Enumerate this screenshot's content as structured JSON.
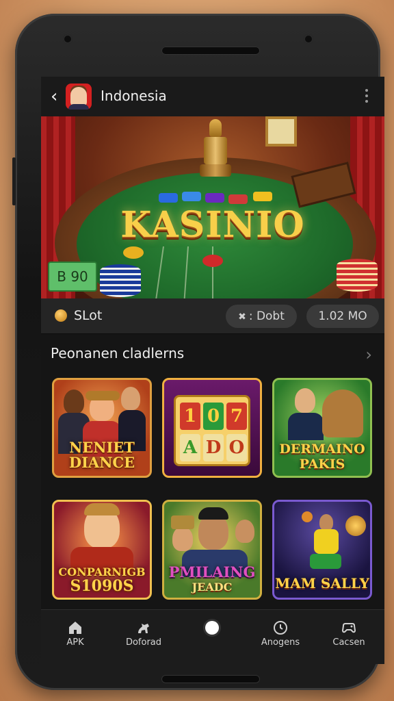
{
  "header": {
    "title": "Indonesia"
  },
  "hero": {
    "logo_text": "KASINIO",
    "money_note": "B 90"
  },
  "info_row": {
    "slot_label": "SLot",
    "pill_1": ": Dobt",
    "pill_2": "1.02 MO"
  },
  "section": {
    "title": "Peonanen cladlerns"
  },
  "games": [
    {
      "label_line1": "NENIET",
      "label_line2": "DIANCE"
    },
    {
      "reels_top": [
        "1",
        "0",
        "7"
      ],
      "reels_bottom": [
        "A",
        "D",
        "O"
      ]
    },
    {
      "label_line1": "DERMAINO",
      "label_line2": "PAKIS"
    },
    {
      "label_line1": "CONPARNIGB",
      "label_line2": "S1090S"
    },
    {
      "label_line1": "PMILAING",
      "label_line2": "JEADC"
    },
    {
      "label_line1": "MAM SALLY",
      "label_line2": ""
    }
  ],
  "bottom_nav": [
    {
      "label": "APK",
      "icon": "home-icon"
    },
    {
      "label": "Doforad",
      "icon": "horse-icon"
    },
    {
      "label": "",
      "icon": "circle-icon"
    },
    {
      "label": "Anogens",
      "icon": "clock-icon"
    },
    {
      "label": "Cacsen",
      "icon": "gamepad-icon"
    }
  ],
  "colors": {
    "background": "#d39a68",
    "accent_gold": "#f8cf4a",
    "felt_green": "#2f8a3a"
  }
}
